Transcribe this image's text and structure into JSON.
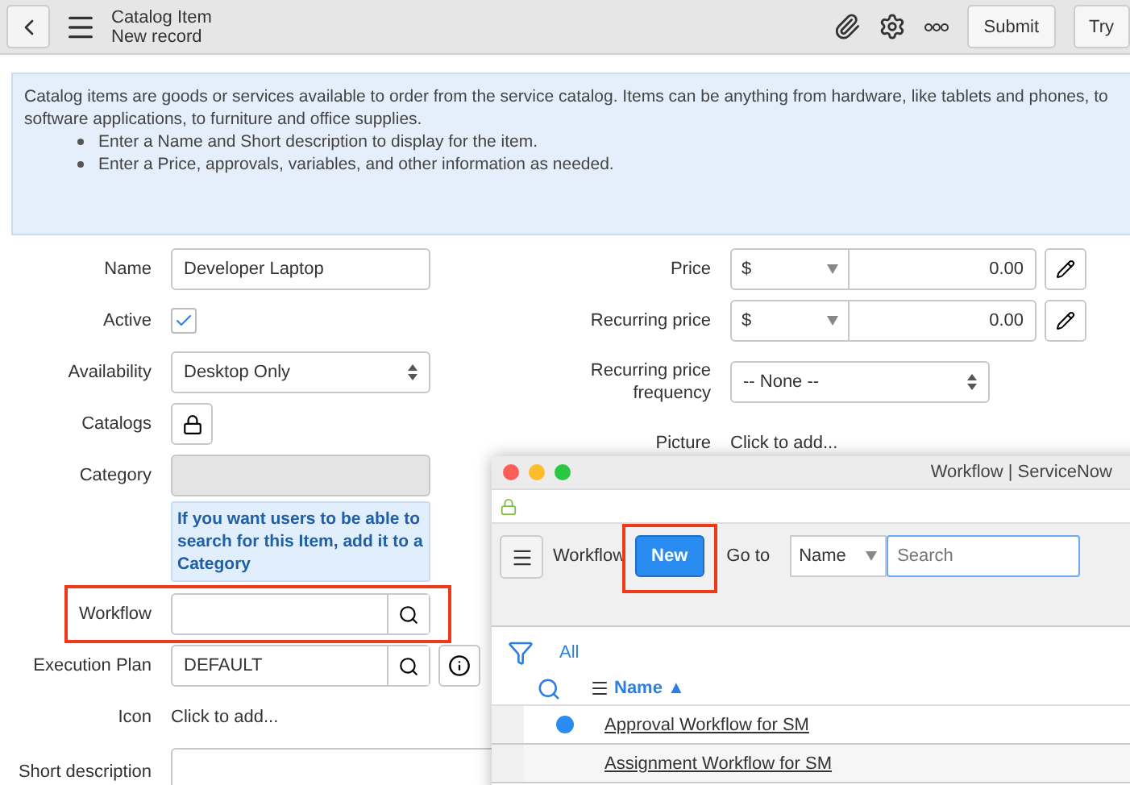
{
  "header": {
    "title": "Catalog Item",
    "subtitle": "New record",
    "buttons": [
      {
        "label": "Submit"
      },
      {
        "label": "Try"
      }
    ]
  },
  "info": {
    "text": "Catalog items are goods or services available to order from the service catalog. Items can be anything from hardware, like tablets and phones, to software applications, to furniture and office supplies.",
    "bullets": [
      "Enter a Name and Short description to display for the item.",
      "Enter a Price, approvals, variables, and other information as needed."
    ]
  },
  "left_fields": [
    {
      "kind": "text",
      "label": "Name",
      "value": "Developer Laptop"
    },
    {
      "kind": "checkbox",
      "label": "Active",
      "checked": true
    },
    {
      "kind": "select",
      "label": "Availability",
      "value": "Desktop Only"
    },
    {
      "kind": "lock",
      "label": "Catalogs"
    },
    {
      "kind": "readonly",
      "label": "Category",
      "hint": "If you want users to be able to search for this Item, add it to a Category"
    },
    {
      "kind": "reference",
      "label": "Workflow",
      "highlighted": true
    },
    {
      "kind": "reference_info",
      "label": "Execution Plan",
      "value": "DEFAULT",
      "highlighted": false
    },
    {
      "kind": "link",
      "label": "Icon",
      "value": "Click to add..."
    },
    {
      "kind": "textarea",
      "label": "Short description"
    }
  ],
  "right_fields": [
    {
      "kind": "price",
      "label": "Price",
      "currency": "$",
      "value": "0.00"
    },
    {
      "kind": "price",
      "label": "Recurring price",
      "currency": "$",
      "value": "0.00"
    },
    {
      "kind": "select",
      "label": "Recurring price frequency",
      "value": "-- None --"
    },
    {
      "kind": "link",
      "label": "Picture",
      "value": "Click to add..."
    }
  ],
  "popup": {
    "title": "Workflow | ServiceNow",
    "toolbar_label": "Workflow",
    "new_button": {
      "label": "New",
      "highlighted": true
    },
    "goto_label": "Go to",
    "goto_select": "Name",
    "search": {
      "placeholder": "Search"
    },
    "filter": "All",
    "column": {
      "label": "Name",
      "sort": "▲"
    },
    "rows": [
      {
        "name": "Approval Workflow for SM",
        "selected": true
      },
      {
        "name": "Assignment Workflow for SM",
        "selected": false
      }
    ]
  }
}
